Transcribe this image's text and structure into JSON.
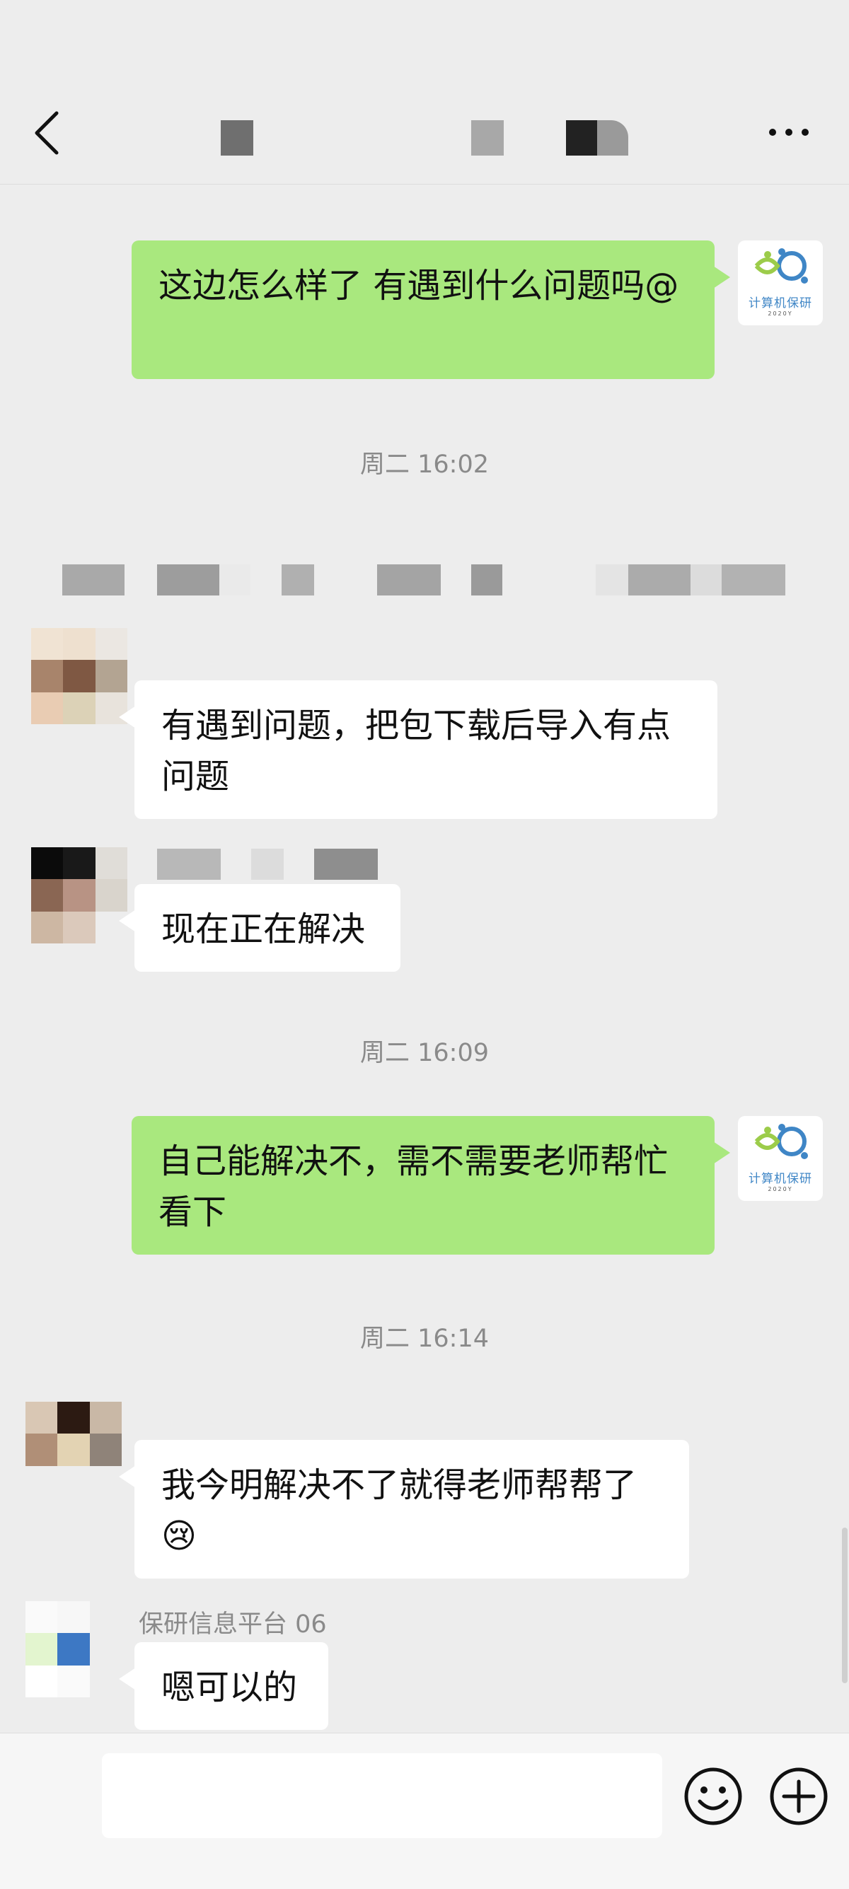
{
  "header": {
    "title": "",
    "back_icon": "chevron-left-icon",
    "more_icon": "more-icon"
  },
  "messages": [
    {
      "type": "sent",
      "text": "这边怎么样了 有遇到什么问题吗@"
    },
    {
      "type": "timestamp",
      "text": "周二 16:02"
    },
    {
      "type": "received",
      "text": "有遇到问题，把包下载后导入有点问题"
    },
    {
      "type": "received",
      "text": "现在正在解决"
    },
    {
      "type": "timestamp",
      "text": "周二 16:09"
    },
    {
      "type": "sent",
      "text": "自己能解决不，需不需要老师帮忙看下"
    },
    {
      "type": "timestamp",
      "text": "周二 16:14"
    },
    {
      "type": "received",
      "text": "我今明解决不了就得老师帮帮了",
      "emoji": "😢"
    },
    {
      "type": "received",
      "sender": "保研信息平台 06",
      "text": "嗯可以的"
    }
  ],
  "my_avatar": {
    "caption": "计算机保研",
    "year": "2020Y"
  },
  "input_bar": {
    "value": "",
    "emoji_icon": "smiley-icon",
    "plus_icon": "plus-circle-icon"
  },
  "colors": {
    "background": "#ededed",
    "sent_bubble": "#a9e87e",
    "received_bubble": "#ffffff",
    "timestamp": "#8a8a8a"
  }
}
